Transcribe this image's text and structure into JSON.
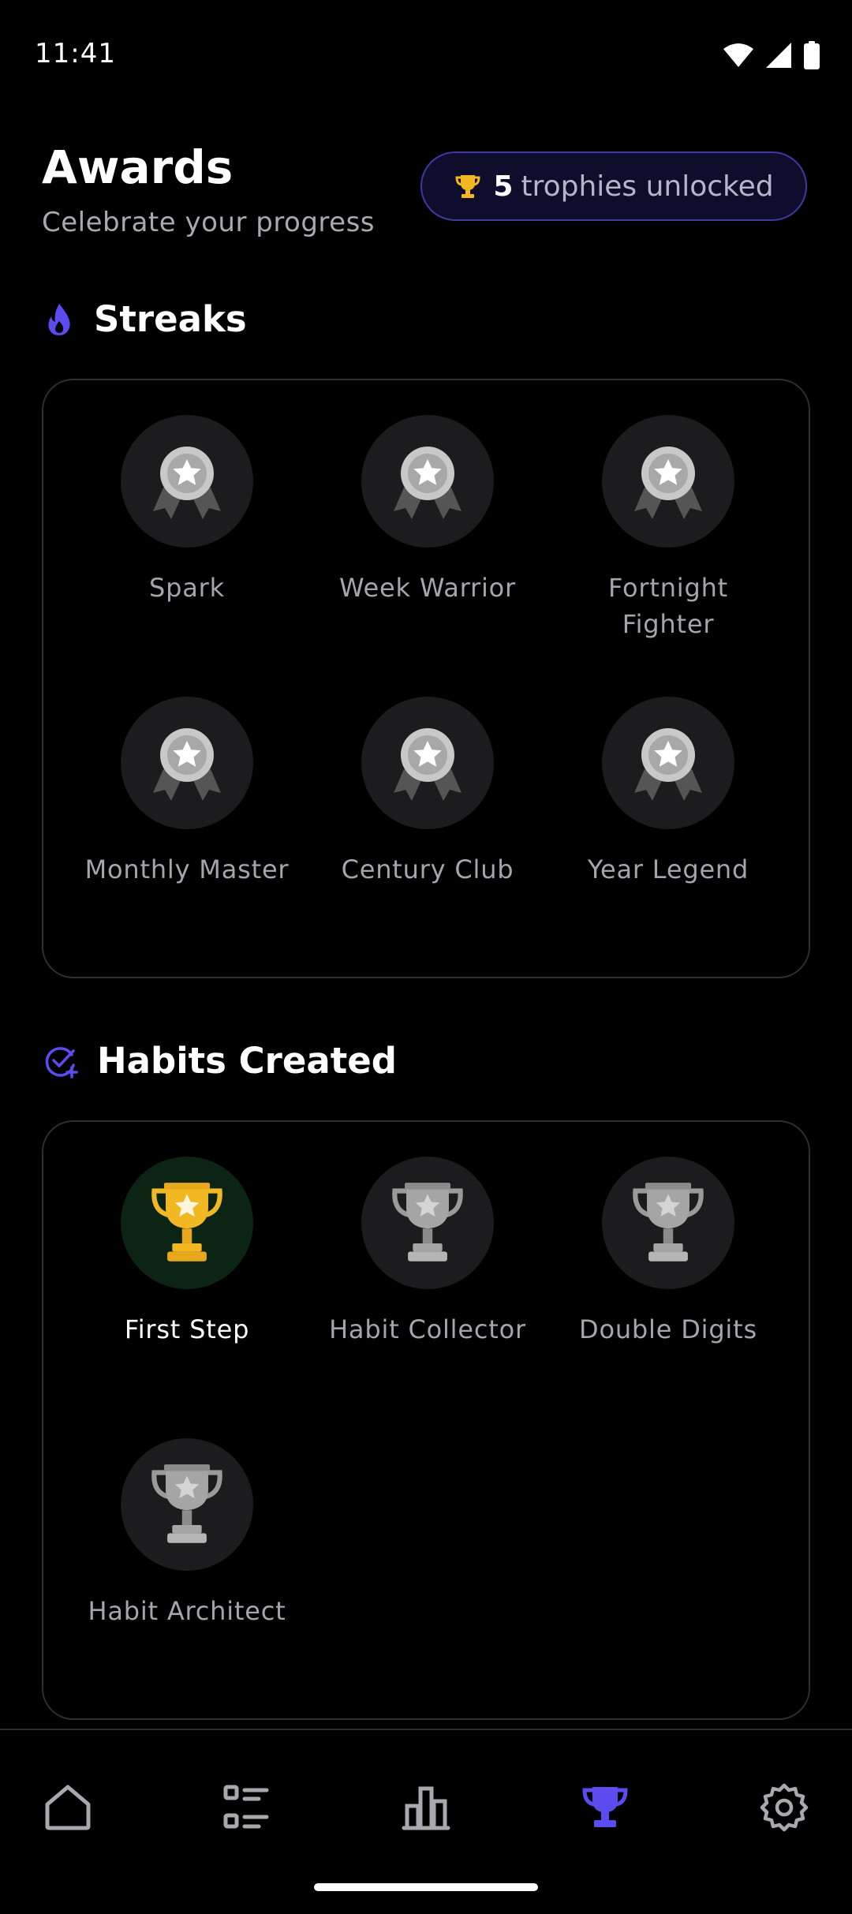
{
  "status_bar": {
    "time": "11:41"
  },
  "header": {
    "title": "Awards",
    "subtitle": "Celebrate your progress",
    "trophy_count": "5",
    "trophy_text": "trophies unlocked"
  },
  "sections": {
    "streaks": {
      "title": "Streaks",
      "icon": "flame-icon",
      "items": [
        {
          "label": "Spark",
          "unlocked": false
        },
        {
          "label": "Week Warrior",
          "unlocked": false
        },
        {
          "label": "Fortnight Fighter",
          "unlocked": false
        },
        {
          "label": "Monthly Master",
          "unlocked": false
        },
        {
          "label": "Century Club",
          "unlocked": false
        },
        {
          "label": "Year Legend",
          "unlocked": false
        }
      ]
    },
    "habits": {
      "title": "Habits Created",
      "icon": "check-add-icon",
      "items": [
        {
          "label": "First Step",
          "unlocked": true
        },
        {
          "label": "Habit Collector",
          "unlocked": false
        },
        {
          "label": "Double Digits",
          "unlocked": false
        },
        {
          "label": "Habit Architect",
          "unlocked": false
        }
      ]
    }
  },
  "bottom_nav": {
    "items": [
      {
        "icon": "home-icon",
        "active": false
      },
      {
        "icon": "list-icon",
        "active": false
      },
      {
        "icon": "bar-chart-icon",
        "active": false
      },
      {
        "icon": "trophy-icon",
        "active": true
      },
      {
        "icon": "gear-icon",
        "active": false
      }
    ]
  },
  "colors": {
    "accent": "#5b4cf0",
    "gold": "#f2b824",
    "medal_silver": "#c8c8c8",
    "background": "#000000"
  }
}
